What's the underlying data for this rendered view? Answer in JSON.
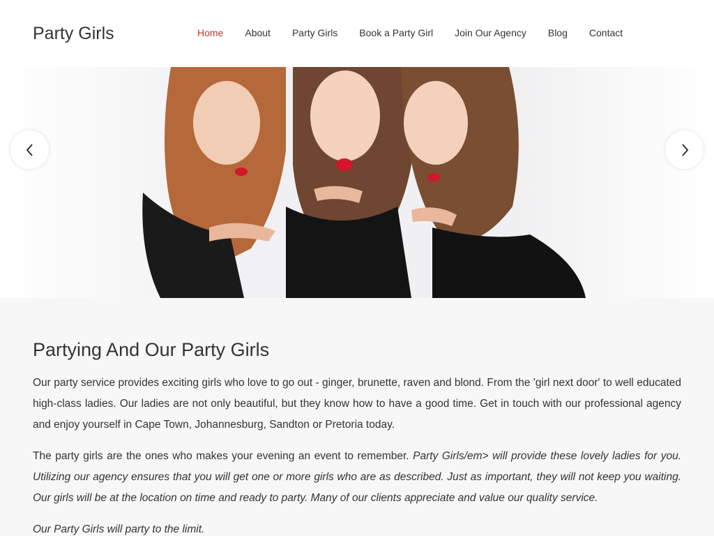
{
  "header": {
    "brand": "Party Girls",
    "nav": [
      {
        "label": "Home",
        "active": true
      },
      {
        "label": "About",
        "active": false
      },
      {
        "label": "Party Girls",
        "active": false
      },
      {
        "label": "Book a Party Girl",
        "active": false
      },
      {
        "label": "Join Our Agency",
        "active": false
      },
      {
        "label": "Blog",
        "active": false
      },
      {
        "label": "Contact",
        "active": false
      }
    ]
  },
  "hero": {
    "prev_icon": "chevron-left-icon",
    "next_icon": "chevron-right-icon"
  },
  "colors": {
    "active_nav": "#c0392b",
    "page_bg": "#f7f7f8",
    "text": "#333333"
  },
  "content": {
    "title": "Partying And Our Party Girls",
    "paragraph1": "Our party service provides exciting girls who love to go out - ginger, brunette, raven and blond. From the 'girl next door' to well educated high-class ladies. Our ladies are not only beautiful, but they know how to have a good time. Get in touch with our professional agency and enjoy yourself in Cape Town, Johannesburg, Sandton or Pretoria today.",
    "paragraph2_plain": "The party girls are the ones who makes your evening an event to remember. ",
    "paragraph2_italic": "Party Girls/em> will provide these lovely ladies for you. Utilizing our agency ensures that you will get one or more girls who are as described. Just as important, they will not keep you waiting. Our girls will be at the location on time and ready to party. Many of our clients appreciate and value our quality service.",
    "paragraph3": "Our Party Girls will party to the limit."
  }
}
